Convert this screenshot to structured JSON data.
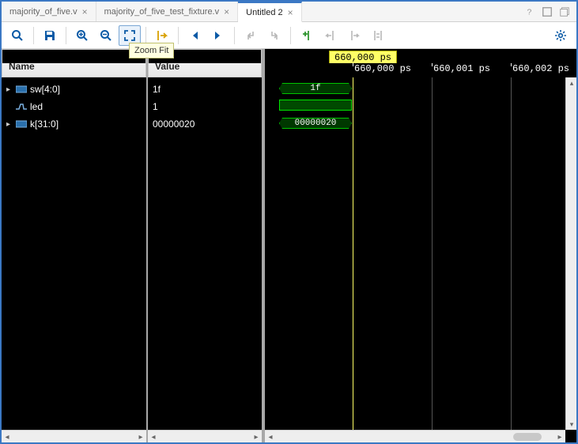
{
  "tabs": [
    {
      "label": "majority_of_five.v",
      "active": false
    },
    {
      "label": "majority_of_five_test_fixture.v",
      "active": false
    },
    {
      "label": "Untitled 2",
      "active": true
    }
  ],
  "toolbar": {
    "tooltip": "Zoom Fit"
  },
  "columns": {
    "name": "Name",
    "value": "Value"
  },
  "signals": [
    {
      "name": "sw[4:0]",
      "value": "1f",
      "expandable": true,
      "icon": "bus",
      "wave_value": "1f",
      "shape": "bus"
    },
    {
      "name": "led",
      "value": "1",
      "expandable": false,
      "icon": "wire",
      "wave_value": "",
      "shape": "line"
    },
    {
      "name": "k[31:0]",
      "value": "00000020",
      "expandable": true,
      "icon": "bus",
      "wave_value": "00000020",
      "shape": "bus"
    }
  ],
  "timescale": {
    "cursor": "660,000 ps",
    "ticks": [
      "660,000 ps",
      "660,001 ps",
      "660,002 ps"
    ]
  }
}
